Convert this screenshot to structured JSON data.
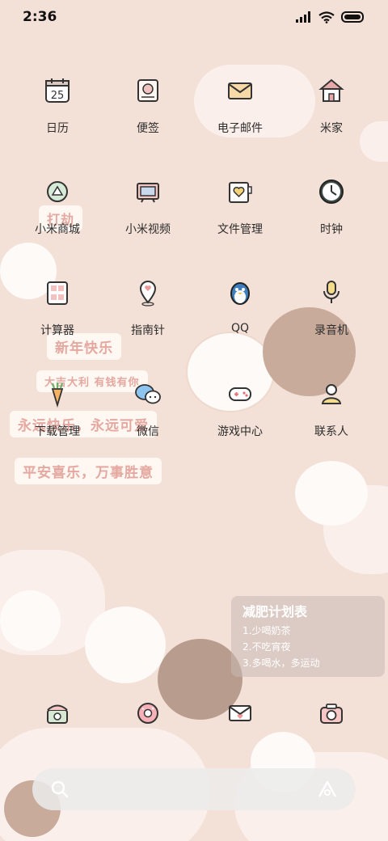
{
  "status_bar": {
    "time": "2:36"
  },
  "apps": [
    {
      "label": "日历",
      "icon": "calendar-icon",
      "day": "25"
    },
    {
      "label": "便签",
      "icon": "notes-icon"
    },
    {
      "label": "电子邮件",
      "icon": "mail-icon"
    },
    {
      "label": "米家",
      "icon": "mijia-house-icon"
    },
    {
      "label": "小米商城",
      "icon": "store-bag-icon"
    },
    {
      "label": "小米视频",
      "icon": "video-tv-icon"
    },
    {
      "label": "文件管理",
      "icon": "folder-heart-icon"
    },
    {
      "label": "时钟",
      "icon": "clock-icon"
    },
    {
      "label": "计算器",
      "icon": "calculator-icon"
    },
    {
      "label": "指南针",
      "icon": "location-pin-icon"
    },
    {
      "label": "QQ",
      "icon": "qq-penguin-icon"
    },
    {
      "label": "录音机",
      "icon": "microphone-icon"
    },
    {
      "label": "下载管理",
      "icon": "carrot-download-icon"
    },
    {
      "label": "微信",
      "icon": "wechat-bubbles-icon"
    },
    {
      "label": "游戏中心",
      "icon": "gamepad-icon"
    },
    {
      "label": "联系人",
      "icon": "contact-person-icon"
    }
  ],
  "dock": [
    {
      "icon": "phone-icon"
    },
    {
      "icon": "donut-messages-icon"
    },
    {
      "icon": "envelope-heart-icon"
    },
    {
      "icon": "camera-icon"
    }
  ],
  "wallpaper_stickers": {
    "dajie": "打劫",
    "new_year": "新年快乐",
    "fortune": "大吉大利 有钱有你",
    "happy_forever": "永远快乐，永远可爱",
    "peace": "平安喜乐，万事胜意",
    "diet_title": "减肥计划表",
    "diet_items": [
      "1.少喝奶茶",
      "2.不吃宵夜",
      "3.多喝水，多运动"
    ]
  },
  "colors": {
    "background": "#f3e0d7",
    "sticker_text": "#e4a8a0",
    "search_bar": "#ebebeb"
  }
}
